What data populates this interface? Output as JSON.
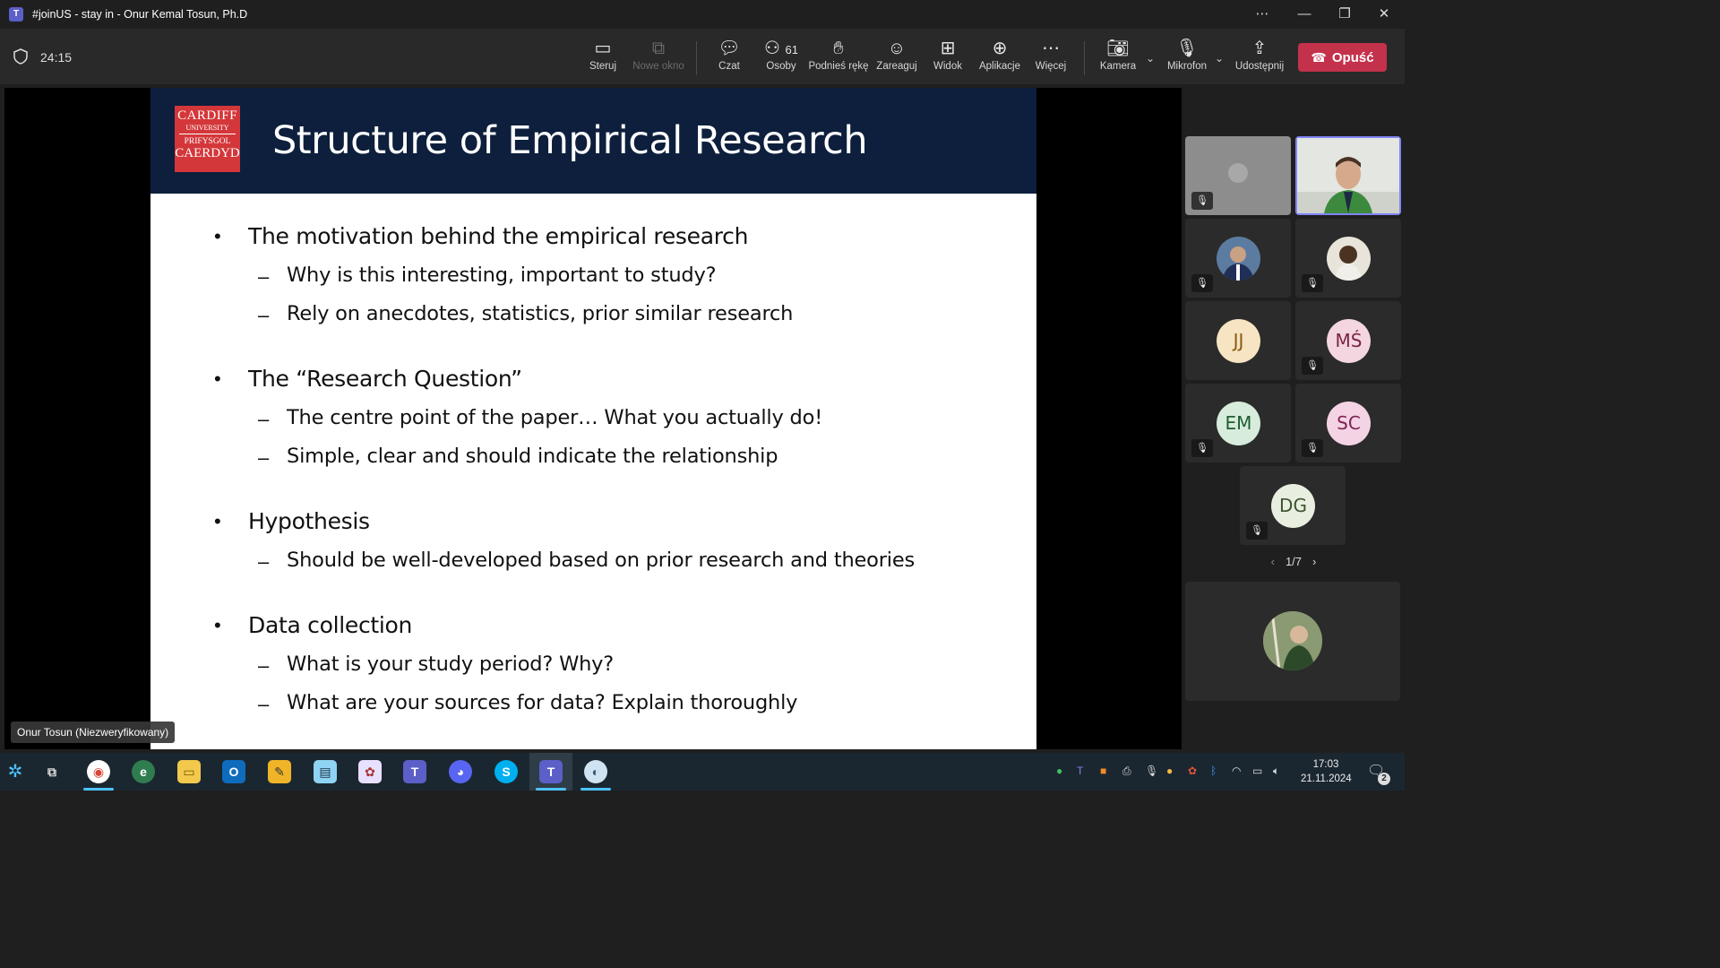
{
  "window": {
    "title": "#joinUS - stay in - Onur Kemal Tosun, Ph.D",
    "controls": [
      "more-icon",
      "minimize-icon",
      "restore-icon",
      "close-icon"
    ]
  },
  "toolbar": {
    "timer": "24:15",
    "buttons": [
      {
        "label": "Steruj",
        "icon": "control-icon"
      },
      {
        "label": "Nowe okno",
        "icon": "new-window-icon",
        "disabled": true
      },
      {
        "label": "Czat",
        "icon": "chat-icon"
      },
      {
        "label": "Osoby",
        "icon": "people-icon",
        "count": "61"
      },
      {
        "label": "Podnieś rękę",
        "icon": "raise-hand-icon"
      },
      {
        "label": "Zareaguj",
        "icon": "react-icon"
      },
      {
        "label": "Widok",
        "icon": "view-icon"
      },
      {
        "label": "Aplikacje",
        "icon": "apps-icon"
      },
      {
        "label": "Więcej",
        "icon": "more-icon"
      },
      {
        "label": "Kamera",
        "icon": "camera-off-icon"
      },
      {
        "label": "Mikrofon",
        "icon": "mic-icon"
      },
      {
        "label": "Udostępnij",
        "icon": "share-icon"
      }
    ],
    "leave_label": "Opuść",
    "leave_color": "#c4314b"
  },
  "slide": {
    "logo": {
      "line1": "CARDIFF",
      "line2": "UNIVERSITY",
      "line3": "PRIFYSGOL",
      "line4": "CAERDYD"
    },
    "title": "Structure of Empirical Research",
    "header_color": "#0d1f3c",
    "bullets": [
      {
        "text": "The motivation behind the empirical research",
        "subs": [
          "Why is this interesting, important to study?",
          "Rely on anecdotes, statistics, prior similar research"
        ]
      },
      {
        "text": "The “Research Question”",
        "subs": [
          "The centre point of the paper… What you actually do!",
          "Simple, clear and should indicate the relationship"
        ]
      },
      {
        "text": "Hypothesis",
        "subs": [
          "Should be well-developed based on prior research and theories"
        ]
      },
      {
        "text": "Data collection",
        "subs": [
          "What is your study period? Why?",
          "What are your sources for data? Explain thoroughly"
        ]
      }
    ]
  },
  "presenter_tag": "Onur Tosun (Niezweryfikowany)",
  "participants": [
    {
      "initials": "",
      "type": "blurred",
      "muted": true
    },
    {
      "initials": "",
      "type": "video",
      "muted": false,
      "active": true
    },
    {
      "initials": "",
      "type": "photo",
      "muted": true
    },
    {
      "initials": "",
      "type": "photo",
      "muted": true
    },
    {
      "initials": "JJ",
      "type": "initials",
      "muted": false,
      "bg": "#f6e4c3",
      "fg": "#8a5a12"
    },
    {
      "initials": "MŚ",
      "type": "initials",
      "muted": true,
      "bg": "#f3d6e0",
      "fg": "#7a2345"
    },
    {
      "initials": "EM",
      "type": "initials",
      "muted": true,
      "bg": "#d7ecdc",
      "fg": "#1f5d31"
    },
    {
      "initials": "SC",
      "type": "initials",
      "muted": true,
      "bg": "#f4d4e4",
      "fg": "#802453"
    },
    {
      "initials": "DG",
      "type": "initials",
      "muted": true,
      "bg": "#e9efe0",
      "fg": "#3d5230"
    }
  ],
  "pager": {
    "label": "1/7"
  },
  "taskbar": {
    "time": "17:03",
    "date": "21.11.2024",
    "notification_count": "2"
  }
}
